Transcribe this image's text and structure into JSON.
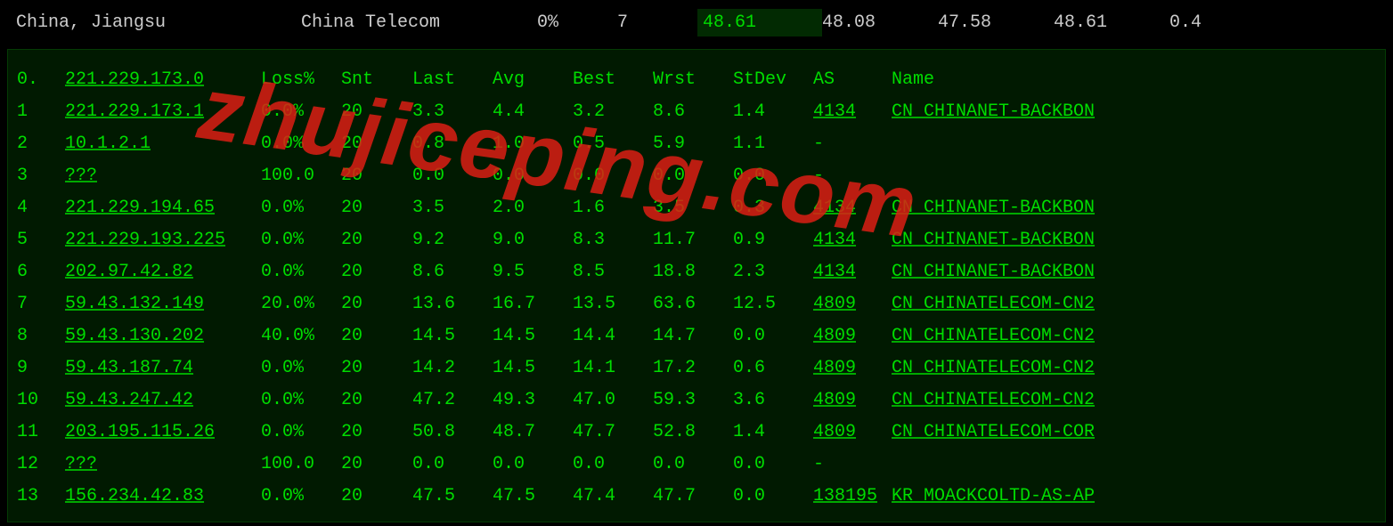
{
  "top": {
    "location": "China, Jiangsu",
    "provider": "China Telecom",
    "loss": "0%",
    "count": "7",
    "v1": "48.61",
    "v2": "48.08",
    "v3": "47.58",
    "v4": "48.61",
    "v5": "0.4"
  },
  "header": {
    "hop": "0.",
    "host": "221.229.173.0",
    "loss": "Loss%",
    "snt": "Snt",
    "last": "Last",
    "avg": "Avg",
    "best": "Best",
    "wrst": "Wrst",
    "stdev": "StDev",
    "as": "AS",
    "name": "Name"
  },
  "rows": [
    {
      "hop": "1",
      "host": "221.229.173.1",
      "loss": "0.0%",
      "snt": "20",
      "last": "3.3",
      "avg": "4.4",
      "best": "3.2",
      "wrst": "8.6",
      "stdev": "1.4",
      "as": "4134",
      "name": "CN CHINANET-BACKBON"
    },
    {
      "hop": "2",
      "host": "10.1.2.1",
      "loss": "0.0%",
      "snt": "20",
      "last": "0.8",
      "avg": "1.0",
      "best": "0.5",
      "wrst": "5.9",
      "stdev": "1.1",
      "as": "-",
      "name": ""
    },
    {
      "hop": "3",
      "host": "???",
      "loss": "100.0",
      "snt": "20",
      "last": "0.0",
      "avg": "0.0",
      "best": "0.0",
      "wrst": "0.0",
      "stdev": "0.0",
      "as": "-",
      "name": ""
    },
    {
      "hop": "4",
      "host": "221.229.194.65",
      "loss": "0.0%",
      "snt": "20",
      "last": "3.5",
      "avg": "2.0",
      "best": "1.6",
      "wrst": "3.5",
      "stdev": "0.3",
      "as": "4134",
      "name": "CN CHINANET-BACKBON"
    },
    {
      "hop": "5",
      "host": "221.229.193.225",
      "loss": "0.0%",
      "snt": "20",
      "last": "9.2",
      "avg": "9.0",
      "best": "8.3",
      "wrst": "11.7",
      "stdev": "0.9",
      "as": "4134",
      "name": "CN CHINANET-BACKBON"
    },
    {
      "hop": "6",
      "host": "202.97.42.82",
      "loss": "0.0%",
      "snt": "20",
      "last": "8.6",
      "avg": "9.5",
      "best": "8.5",
      "wrst": "18.8",
      "stdev": "2.3",
      "as": "4134",
      "name": "CN CHINANET-BACKBON"
    },
    {
      "hop": "7",
      "host": "59.43.132.149",
      "loss": "20.0%",
      "snt": "20",
      "last": "13.6",
      "avg": "16.7",
      "best": "13.5",
      "wrst": "63.6",
      "stdev": "12.5",
      "as": "4809",
      "name": "CN CHINATELECOM-CN2"
    },
    {
      "hop": "8",
      "host": "59.43.130.202",
      "loss": "40.0%",
      "snt": "20",
      "last": "14.5",
      "avg": "14.5",
      "best": "14.4",
      "wrst": "14.7",
      "stdev": "0.0",
      "as": "4809",
      "name": "CN CHINATELECOM-CN2"
    },
    {
      "hop": "9",
      "host": "59.43.187.74",
      "loss": "0.0%",
      "snt": "20",
      "last": "14.2",
      "avg": "14.5",
      "best": "14.1",
      "wrst": "17.2",
      "stdev": "0.6",
      "as": "4809",
      "name": "CN CHINATELECOM-CN2"
    },
    {
      "hop": "10",
      "host": "59.43.247.42",
      "loss": "0.0%",
      "snt": "20",
      "last": "47.2",
      "avg": "49.3",
      "best": "47.0",
      "wrst": "59.3",
      "stdev": "3.6",
      "as": "4809",
      "name": "CN CHINATELECOM-CN2"
    },
    {
      "hop": "11",
      "host": "203.195.115.26",
      "loss": "0.0%",
      "snt": "20",
      "last": "50.8",
      "avg": "48.7",
      "best": "47.7",
      "wrst": "52.8",
      "stdev": "1.4",
      "as": "4809",
      "name": "CN CHINATELECOM-COR"
    },
    {
      "hop": "12",
      "host": "???",
      "loss": "100.0",
      "snt": "20",
      "last": "0.0",
      "avg": "0.0",
      "best": "0.0",
      "wrst": "0.0",
      "stdev": "0.0",
      "as": "-",
      "name": ""
    },
    {
      "hop": "13",
      "host": "156.234.42.83",
      "loss": "0.0%",
      "snt": "20",
      "last": "47.5",
      "avg": "47.5",
      "best": "47.4",
      "wrst": "47.7",
      "stdev": "0.0",
      "as": "138195",
      "name": "KR MOACKCOLTD-AS-AP"
    }
  ],
  "watermark": "zhujiceping.com"
}
